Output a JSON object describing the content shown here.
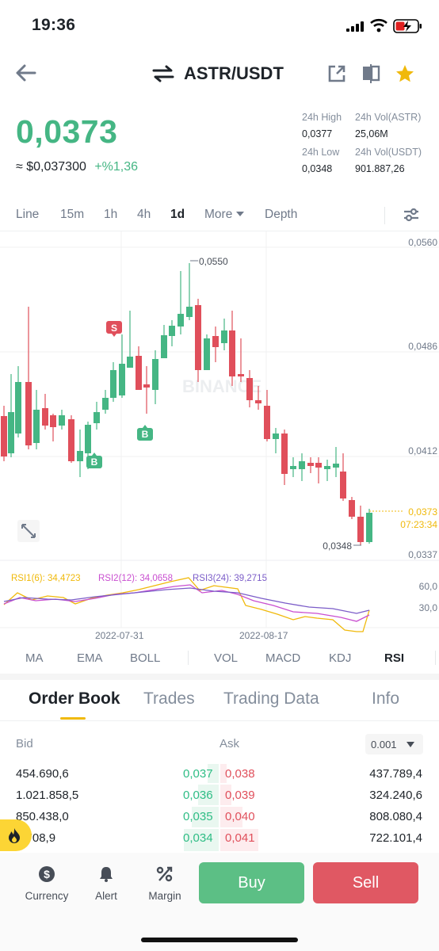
{
  "status_bar": {
    "time": "19:36"
  },
  "header": {
    "pair": "ASTR/USDT"
  },
  "ticker": {
    "last_price": "0,0373",
    "fiat_price": "≈ $0,037300",
    "change": "+%1,36",
    "high_label": "24h High",
    "high_value": "0,0377",
    "low_label": "24h Low",
    "low_value": "0,0348",
    "vol_base_label": "24h Vol(ASTR)",
    "vol_base_value": "25,06M",
    "vol_quote_label": "24h Vol(USDT)",
    "vol_quote_value": "901.887,26"
  },
  "intervals": [
    "Line",
    "15m",
    "1h",
    "4h",
    "1d",
    "More",
    "Depth"
  ],
  "active_interval": "1d",
  "chart": {
    "y_labels": [
      "0,0560",
      "0,0486",
      "0,0412",
      "0,0337"
    ],
    "high_marker": "0,0550",
    "low_marker": "0,0348",
    "last_price_label": "0,0373",
    "countdown": "07:23:34",
    "watermark": "BINANCE",
    "signals": [
      "S",
      "B",
      "B"
    ],
    "rsi_legend": {
      "rsi1": "RSI1(6): 34,4723",
      "rsi2": "RSI2(12): 34,0658",
      "rsi3": "RSI3(24): 39,2715"
    },
    "rsi_levels": [
      "60,0",
      "30,0"
    ],
    "dates": [
      "2022-07-31",
      "2022-08-17"
    ],
    "colors": {
      "up": "#45b684",
      "down": "#e04f5b",
      "rsi1": "#f0b90b",
      "rsi2": "#c94fd0",
      "rsi3": "#7b5cc8"
    }
  },
  "indicator_tabs": [
    "MA",
    "EMA",
    "BOLL",
    "VOL",
    "MACD",
    "KDJ",
    "RSI"
  ],
  "active_indicator": "RSI",
  "orderbook": {
    "tabs": [
      "Order Book",
      "Trades",
      "Trading Data",
      "Info"
    ],
    "active_tab": "Order Book",
    "bid_label": "Bid",
    "ask_label": "Ask",
    "precision": "0.001",
    "rows": [
      {
        "bid_qty": "454.690,6",
        "bid_price": "0,037",
        "ask_price": "0,038",
        "ask_qty": "437.789,4"
      },
      {
        "bid_qty": "1.021.858,5",
        "bid_price": "0,036",
        "ask_price": "0,039",
        "ask_qty": "324.240,6"
      },
      {
        "bid_qty": "850.438,0",
        "bid_price": "0,035",
        "ask_price": "0,040",
        "ask_qty": "808.080,4"
      },
      {
        "bid_qty": "7.708,9",
        "bid_price": "0,034",
        "ask_price": "0,041",
        "ask_qty": "722.101,4"
      }
    ]
  },
  "bottom_nav": {
    "currency": "Currency",
    "alert": "Alert",
    "margin": "Margin",
    "buy": "Buy",
    "sell": "Sell"
  }
}
